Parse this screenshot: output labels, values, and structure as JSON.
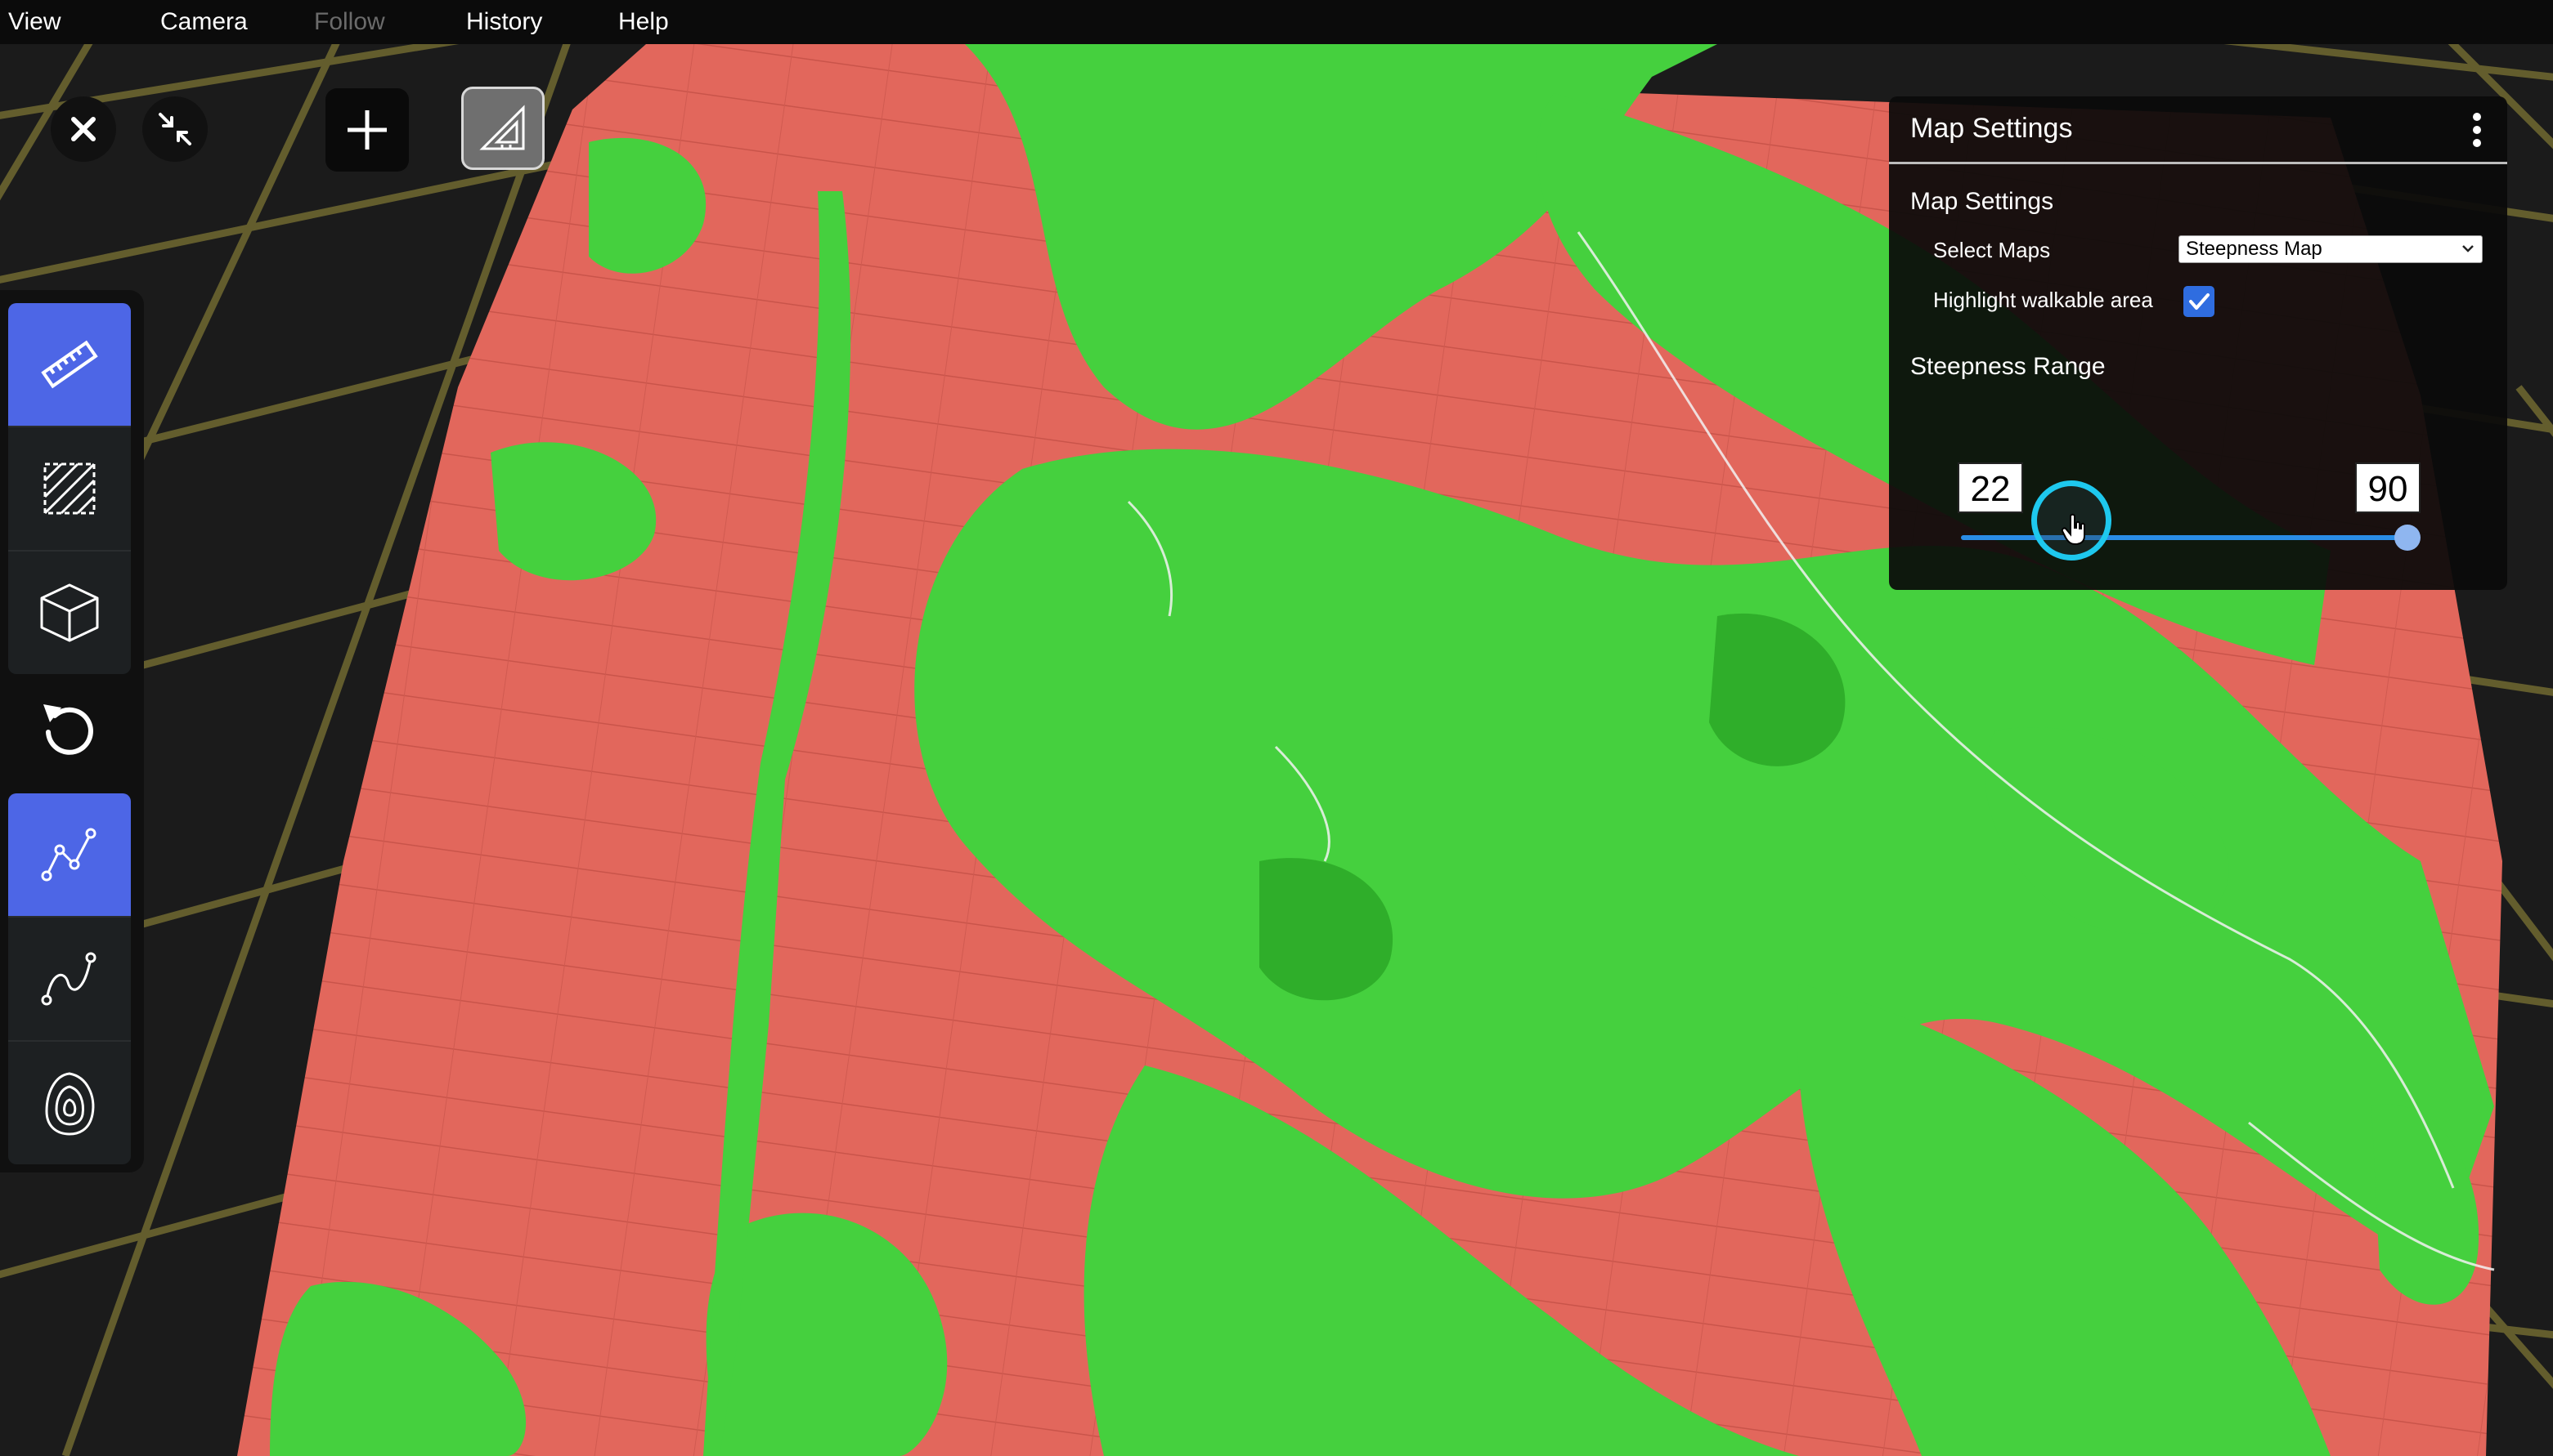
{
  "menu": {
    "items": [
      {
        "label": "View",
        "disabled": false
      },
      {
        "label": "Camera",
        "disabled": false
      },
      {
        "label": "Follow",
        "disabled": true
      },
      {
        "label": "History",
        "disabled": false
      },
      {
        "label": "Help",
        "disabled": false
      }
    ]
  },
  "toolbar": {
    "close_icon": "close-icon",
    "collapse_icon": "collapse-arrows-icon",
    "add_icon": "plus-icon",
    "measure_angle_icon": "set-square-icon"
  },
  "left_tools": [
    {
      "icon": "ruler-icon",
      "active": true
    },
    {
      "icon": "hatched-area-icon",
      "active": false
    },
    {
      "icon": "cube-icon",
      "active": false
    },
    {
      "icon": "undo-icon",
      "active": false
    },
    {
      "icon": "polyline-path-icon",
      "active": true
    },
    {
      "icon": "curve-path-icon",
      "active": false
    },
    {
      "icon": "contour-lines-icon",
      "active": false
    }
  ],
  "map_settings": {
    "panel_title": "Map Settings",
    "section_title": "Map Settings",
    "select_maps_label": "Select Maps",
    "select_maps_value": "Steepness Map",
    "highlight_label": "Highlight walkable area",
    "highlight_checked": true,
    "range_title": "Steepness Range",
    "range_min": "22",
    "range_max": "90",
    "range_min_fraction": 0.244,
    "range_max_fraction": 1.0
  },
  "colors": {
    "accent_blue": "#4d66e6",
    "slider_blue": "#2a8de6",
    "slider_focus": "#1ec8ee",
    "steep_red": "#e2675c",
    "walkable_green": "#45d03e",
    "grid_yellow": "#6b6530"
  }
}
